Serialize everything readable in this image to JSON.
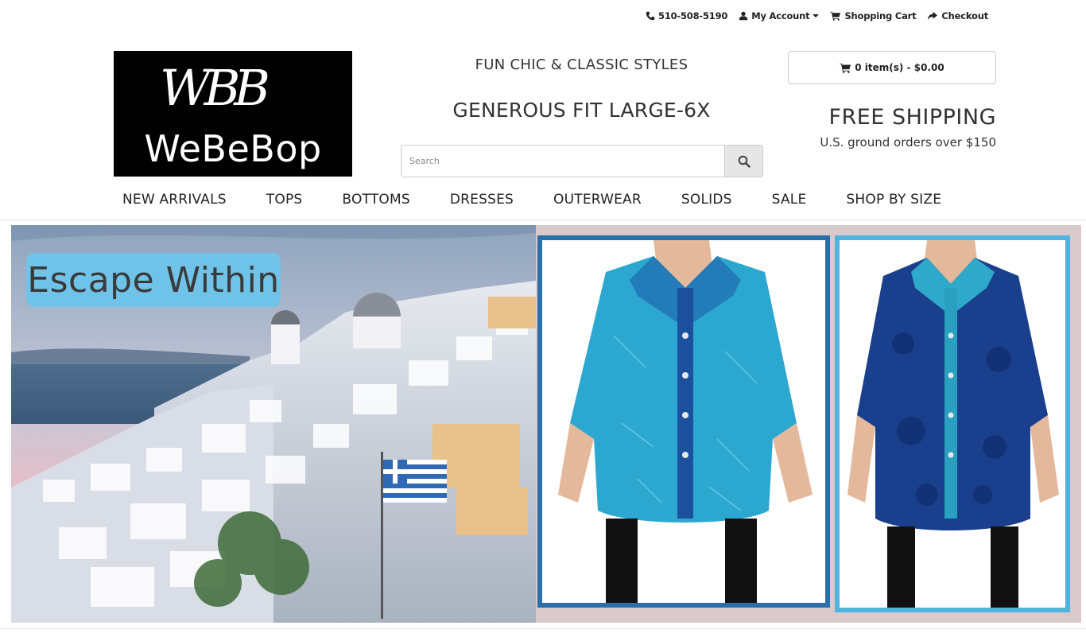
{
  "topbar": {
    "phone": "510-508-5190",
    "account": "My Account",
    "cart": "Shopping Cart",
    "checkout": "Checkout"
  },
  "logo": {
    "monogram": "WBB",
    "brand": "WeBeBop"
  },
  "header": {
    "tagline1": "FUN CHIC & CLASSIC STYLES",
    "tagline2": "GENEROUS FIT LARGE-6X"
  },
  "search": {
    "placeholder": "Search"
  },
  "cart": {
    "label": "0 item(s) - $0.00"
  },
  "shipping": {
    "title": "FREE SHIPPING",
    "subtitle": "U.S. ground orders over $150"
  },
  "nav": {
    "items": [
      "NEW ARRIVALS",
      "TOPS",
      "BOTTOMS",
      "DRESSES",
      "OUTERWEAR",
      "SOLIDS",
      "SALE",
      "SHOP BY SIZE"
    ]
  },
  "banner": {
    "headline": "Escape Within",
    "frame1_color": "#2b6fa8",
    "frame2_color": "#4fb3de",
    "headline_bg": "#6fc3e8"
  }
}
